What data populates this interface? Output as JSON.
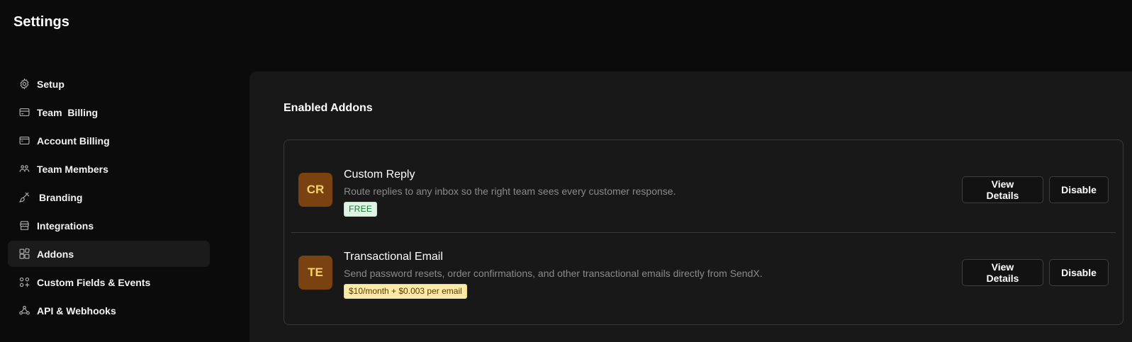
{
  "header": {
    "title": "Settings"
  },
  "sidebar": {
    "items": [
      {
        "label": "Setup",
        "icon": "gear-icon"
      },
      {
        "label": "Team  Billing",
        "icon": "credit-card-icon"
      },
      {
        "label": "Account Billing",
        "icon": "card-icon"
      },
      {
        "label": "Team Members",
        "icon": "users-icon"
      },
      {
        "label": "Branding",
        "icon": "brush-icon"
      },
      {
        "label": "Integrations",
        "icon": "store-icon"
      },
      {
        "label": "Addons",
        "icon": "blocks-icon",
        "active": true
      },
      {
        "label": "Custom Fields & Events",
        "icon": "grid-plus-icon"
      },
      {
        "label": "API & Webhooks",
        "icon": "webhook-icon"
      }
    ]
  },
  "main": {
    "section_title": "Enabled Addons",
    "addons": [
      {
        "initials": "CR",
        "name": "Custom Reply",
        "description": "Route replies to any inbox so the right team sees every customer response.",
        "badge": "FREE",
        "view_label": "View Details",
        "disable_label": "Disable"
      },
      {
        "initials": "TE",
        "name": "Transactional Email",
        "description": "Send password resets, order confirmations, and other transactional emails directly from SendX.",
        "badge": "$10/month + $0.003 per email",
        "view_label": "View Details",
        "disable_label": "Disable"
      }
    ]
  },
  "colors": {
    "background": "#0b0b0b",
    "panel": "#181818",
    "avatar_bg": "#7a4210",
    "avatar_text": "#f7d36b",
    "badge_free_bg": "#dff5e3",
    "badge_price_bg": "#fbe9a7"
  }
}
